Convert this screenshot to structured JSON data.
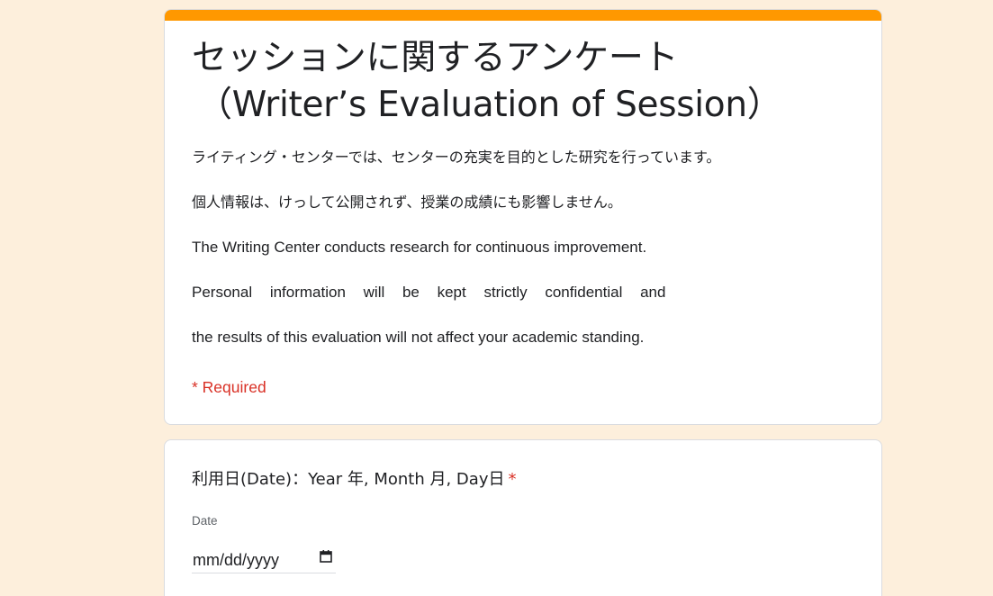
{
  "form": {
    "title_line1": "セッションに関するアンケート",
    "title_line2": "（Writer’s Evaluation of Session）",
    "description": [
      "ライティング・センターでは、センターの充実を目的とした研究を行っています。",
      "個人情報は、けっして公開されず、授業の成績にも影響しません。",
      "The Writing Center conducts research for continuous improvement.",
      "Personal information will be kept strictly confidential and",
      "the results of this evaluation will not affect your academic standing."
    ],
    "required_note": "* Required"
  },
  "question": {
    "title": "利用日(Date)：Year 年, Month 月, Day日",
    "required_mark": "*",
    "field_label": "Date",
    "date_value": "mm/dd/yyyy",
    "icon": "calendar-icon"
  },
  "colors": {
    "background": "#fdefdc",
    "accent": "#ff9800",
    "required": "#d93025"
  }
}
